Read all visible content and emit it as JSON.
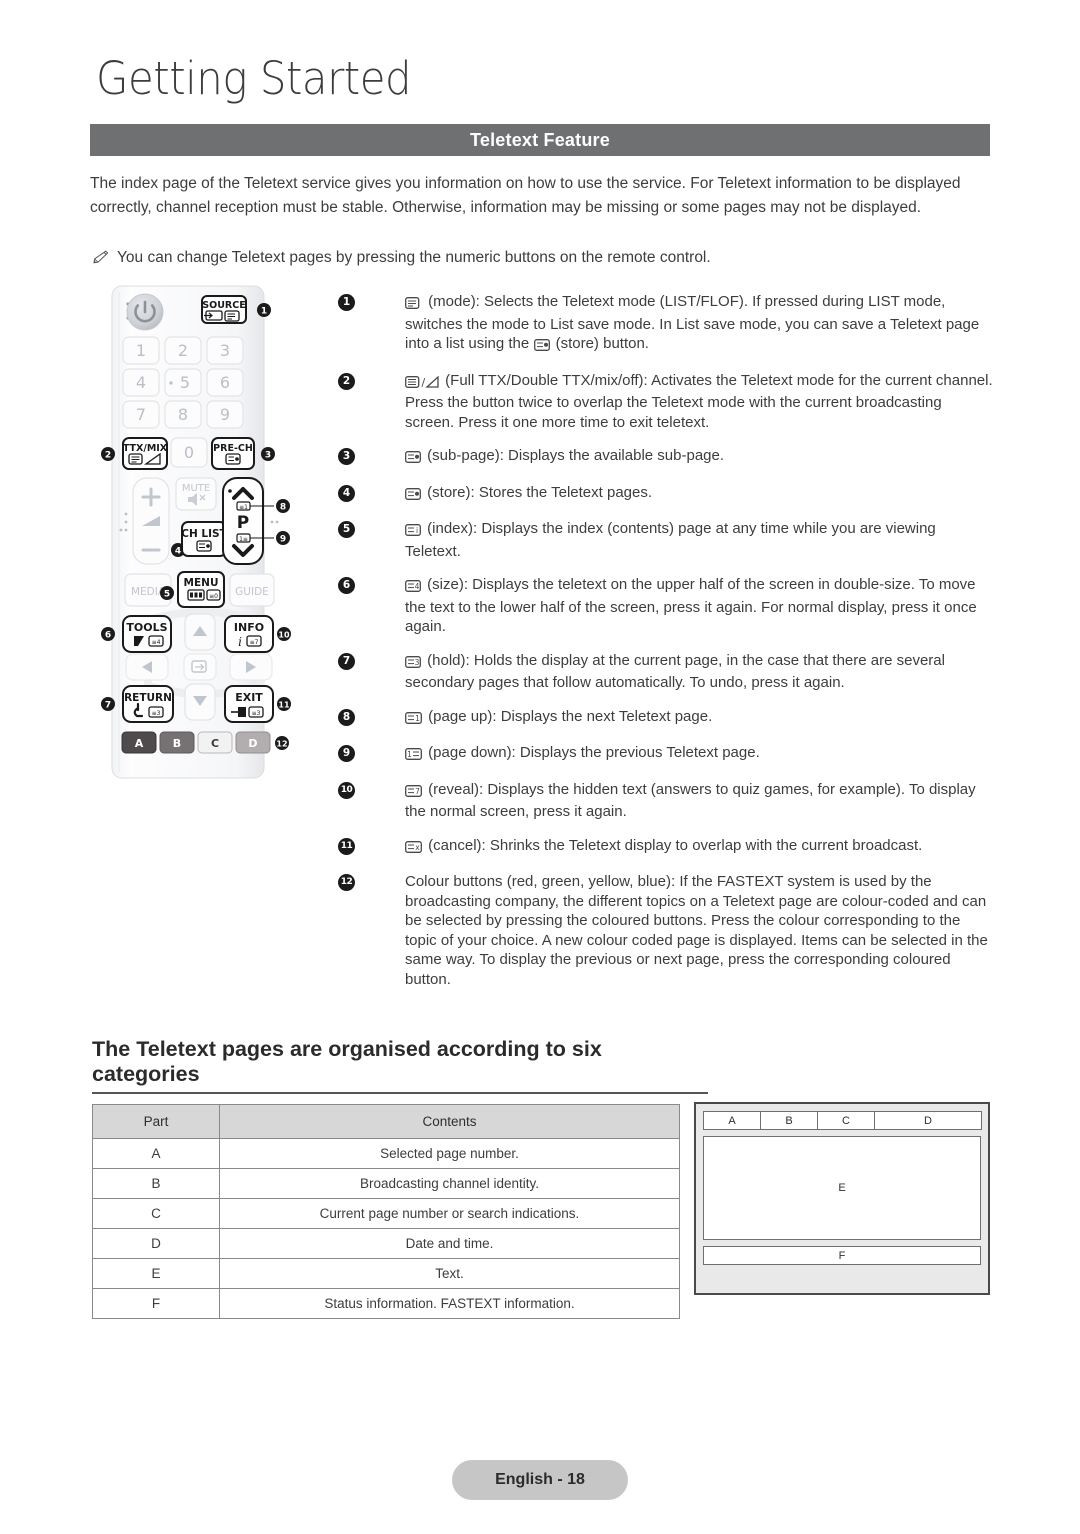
{
  "chapter": {
    "title": "Getting Started"
  },
  "section": {
    "title": "Teletext Feature"
  },
  "intro": {
    "paragraph": "The index page of the Teletext service gives you information on how to use the service. For Teletext information to be displayed correctly, channel reception must be stable. Otherwise, information may be missing or some pages may not be displayed.",
    "note": "You can change Teletext pages by pressing the numeric buttons on the remote control.",
    "note_icon": "pencil-icon"
  },
  "remote": {
    "label": "remote-control-illustration",
    "power_label": "",
    "buttons": {
      "source": "SOURCE",
      "digits": [
        "1",
        "2",
        "3",
        "4",
        "5",
        "6",
        "7",
        "8",
        "9",
        "0"
      ],
      "ttx_mix": "TTX/MIX",
      "pre_ch": "PRE-CH",
      "mute": "MUTE",
      "ch_list": "CH LIST",
      "p_label": "P",
      "media": "MEDIA",
      "menu": "MENU",
      "guide": "GUIDE",
      "tools": "TOOLS",
      "info": "INFO",
      "return": "RETURN",
      "exit": "EXIT",
      "colour": [
        "A",
        "B",
        "C",
        "D"
      ]
    },
    "callouts": [
      "1",
      "2",
      "3",
      "4",
      "5",
      "6",
      "7",
      "8",
      "9",
      "10",
      "11",
      "12"
    ]
  },
  "descriptions": [
    {
      "number": "1",
      "icon": "teletext-mode-icon",
      "text_a": "(mode): Selects the Teletext mode (LIST/FLOF). If pressed during LIST mode, switches the mode to List save mode. In List save mode, you can save a Teletext page into a list using the ",
      "icon2": "teletext-store-icon",
      "text_b": "(store) button."
    },
    {
      "number": "2",
      "icon": "teletext-full-double-icon",
      "text_a": "(Full TTX/Double TTX/mix/off): Activates the Teletext mode for the current channel. Press the button twice to overlap the Teletext mode with the current broadcasting screen. Press it one more time to exit teletext."
    },
    {
      "number": "3",
      "icon": "teletext-subpage-icon",
      "text_a": "(sub-page): Displays the available sub-page."
    },
    {
      "number": "4",
      "icon": "teletext-store-icon",
      "text_a": "(store): Stores the Teletext pages."
    },
    {
      "number": "5",
      "icon": "teletext-index-icon",
      "text_a": "(index): Displays the index (contents) page at any time while you are viewing Teletext."
    },
    {
      "number": "6",
      "icon": "teletext-size-icon",
      "text_a": "(size): Displays the teletext on the upper half of the screen in double-size. To move the text to the lower half of the screen, press it again. For normal display, press it once again."
    },
    {
      "number": "7",
      "icon": "teletext-hold-icon",
      "text_a": "(hold): Holds the display at the current page, in the case that there are several secondary pages that follow automatically. To undo, press it again."
    },
    {
      "number": "8",
      "icon": "teletext-page-up-icon",
      "text_a": "(page up): Displays the next Teletext page."
    },
    {
      "number": "9",
      "icon": "teletext-page-down-icon",
      "text_a": "(page down): Displays the previous Teletext page."
    },
    {
      "number": "10",
      "icon": "teletext-reveal-icon",
      "text_a": "(reveal): Displays the hidden text (answers to quiz games, for example). To display the normal screen, press it again."
    },
    {
      "number": "11",
      "icon": "teletext-cancel-icon",
      "text_a": "(cancel): Shrinks the Teletext display to overlap with the current broadcast."
    },
    {
      "number": "12",
      "icon": "",
      "text_a": "Colour buttons (red, green, yellow, blue): If the FASTEXT system is used by the broadcasting company, the different topics on a Teletext page are colour-coded and can be selected by pressing the coloured buttons. Press the colour corresponding to the topic of your choice. A new colour coded page is displayed. Items can be selected in the same way. To display the previous or next page, press the corresponding coloured button."
    }
  ],
  "subheading": "The Teletext pages are organised according to six categories",
  "table": {
    "headers": [
      "Part",
      "Contents"
    ],
    "rows": [
      [
        "A",
        "Selected page number."
      ],
      [
        "B",
        "Broadcasting channel identity."
      ],
      [
        "C",
        "Current page number or search indications."
      ],
      [
        "D",
        "Date and time."
      ],
      [
        "E",
        "Text."
      ],
      [
        "F",
        "Status information. FASTEXT information."
      ]
    ]
  },
  "diagram": {
    "top_cells": [
      "A",
      "B",
      "C",
      "D"
    ],
    "middle_cell": "E",
    "bottom_cell": "F"
  },
  "footer": {
    "label": "English - 18"
  },
  "colors": {
    "band": "#6e7072",
    "table_header": "#d7d7d7",
    "footer_pill": "#c6c6c6",
    "text": "#3d3d3d"
  }
}
